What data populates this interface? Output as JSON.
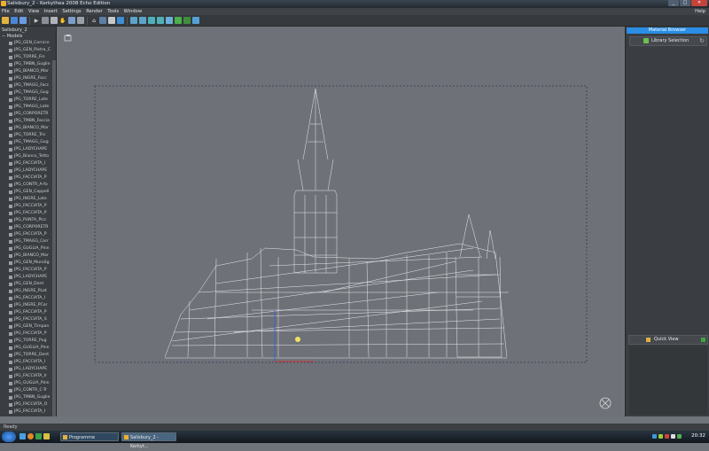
{
  "window": {
    "title": "Salisbury_2 - Kerkythea 2008 Echo Edition",
    "min": "_",
    "max": "□",
    "close": "✕"
  },
  "menu": {
    "items": [
      "File",
      "Edit",
      "View",
      "Insert",
      "Settings",
      "Render",
      "Tools",
      "Window"
    ],
    "help": "Help"
  },
  "scene_tree": {
    "header": "Salisbury_2",
    "root": "Models",
    "items": [
      "JPG_GEN_Cornice",
      "JPG_GEN_Pietra_C",
      "JPG_TORRE_Fin",
      "JPG_TMBN_Guglie",
      "JPG_BIANCO_Mar",
      "JPG_INGRE_Facc",
      "JPG_TMAGG_Facc",
      "JPG_TMAGG_Gug",
      "JPG_TORRE_Late",
      "JPG_TMAGG_Late",
      "JPG_CORPORETR",
      "JPG_TMBN_Faccia",
      "JPG_BIANCO_Mar",
      "JPG_TORRE_Tric",
      "JPG_TMAGG_Gug",
      "JPG_LADYCHAPE",
      "JPG_Bianco_Tetto",
      "JPG_FACCIATA_I",
      "JPG_LADYCHAPE",
      "JPG_FACCIATA_P",
      "JPG_CONTR_A-fo",
      "JPG_GEN_Cappell",
      "JPG_INGRE_Late",
      "JPG_FACCIATA_P",
      "JPG_FACCIATA_P",
      "JPG_PUNTA_Picc",
      "JPG_CORPORETR",
      "JPG_FACCIATA_P",
      "JPG_TMAGG_Corr",
      "JPG_GUGLIA_Pinn",
      "JPG_BIANCO_Mar",
      "JPG_GEN_MuroSg",
      "JPG_FACCIATA_P",
      "JPG_LADYCHAPE",
      "JPG_GEN_Dent",
      "JPG_INGRE_PLat",
      "JPG_FACCIATA_I",
      "JPG_INGRE_PCor",
      "JPG_FACCIATA_P",
      "JPG_FACCIATA_S",
      "JPG_GEN_Timpan",
      "JPG_FACCIATA_P",
      "JPG_TORRE_Pug",
      "JPG_GUGLIA_Pinn",
      "JPG_TORRE_Dent",
      "JPG_FACCIATA_I",
      "JPG_LADYCHAPE",
      "JPG_FACCIATA_Ir",
      "JPG_GUGLIA_Pinn",
      "JPG_CONTR_C-Tr",
      "JPG_TMBN_Guglie",
      "JPG_FACCIATA_O",
      "JPG_FACCIATA_I"
    ]
  },
  "material_browser": {
    "header": "Material Browser",
    "library_label": "Library Selection",
    "refresh_icon": "refresh-icon"
  },
  "quick_view": {
    "label": "Quick View"
  },
  "status": {
    "text": "Ready"
  },
  "taskbar": {
    "tab1": "Programme",
    "tab2": "Salisbury_2 - Kerkyt...",
    "clock": "20:32"
  },
  "colors": {
    "accent": "#2a8ee6",
    "viewport": "#6e7278",
    "panel": "#3a3d41",
    "wire": "#e9e9ec"
  }
}
